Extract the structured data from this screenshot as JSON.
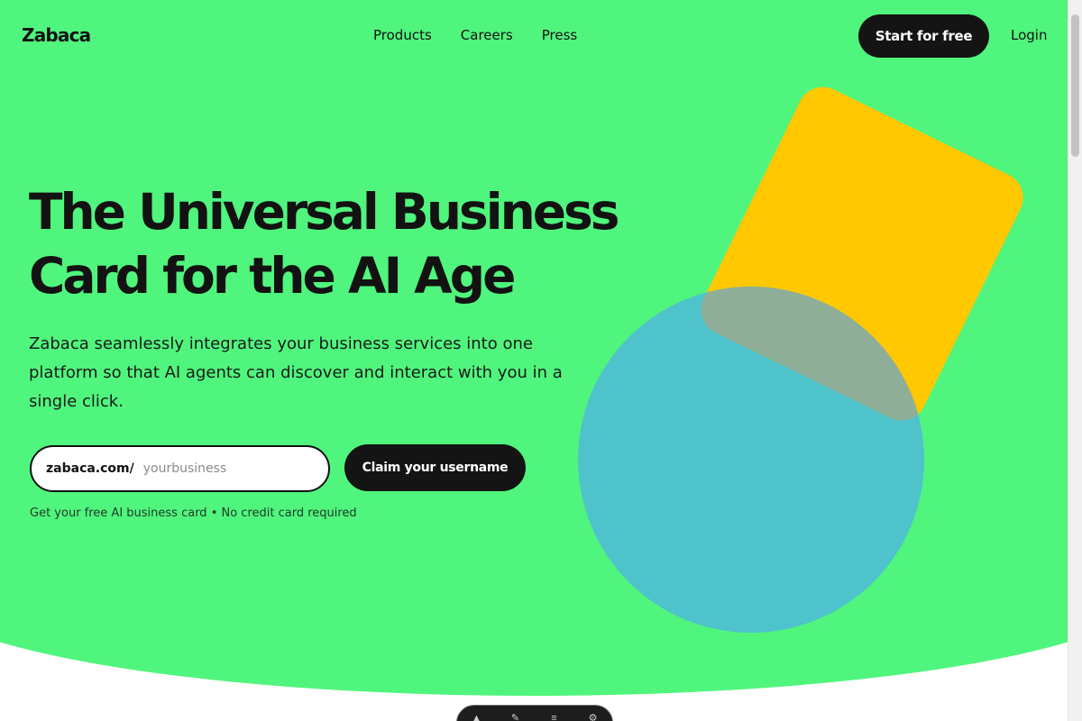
{
  "brand": {
    "logo": "Zabaca",
    "accent_color": "#50f57d",
    "shape_colors": {
      "square": "#ffc800",
      "circle": "#4ec3cb",
      "overlap": "#8fae97"
    }
  },
  "nav": {
    "links": [
      "Products",
      "Careers",
      "Press"
    ],
    "start_button": "Start for free",
    "login": "Login"
  },
  "hero": {
    "headline": "The Universal Business Card for the AI Age",
    "subtext": "Zabaca seamlessly integrates your business services into one platform so that AI agents can discover and interact with you in a single click.",
    "input_prefix": "zabaca.com/",
    "input_placeholder": "yourbusiness",
    "claim_button": "Claim your username",
    "note": "Get your free AI business card • No credit card required"
  },
  "bottom_toolbar": {
    "icons": [
      "pointer-icon",
      "tool-icon",
      "menu-icon",
      "settings-icon"
    ]
  }
}
